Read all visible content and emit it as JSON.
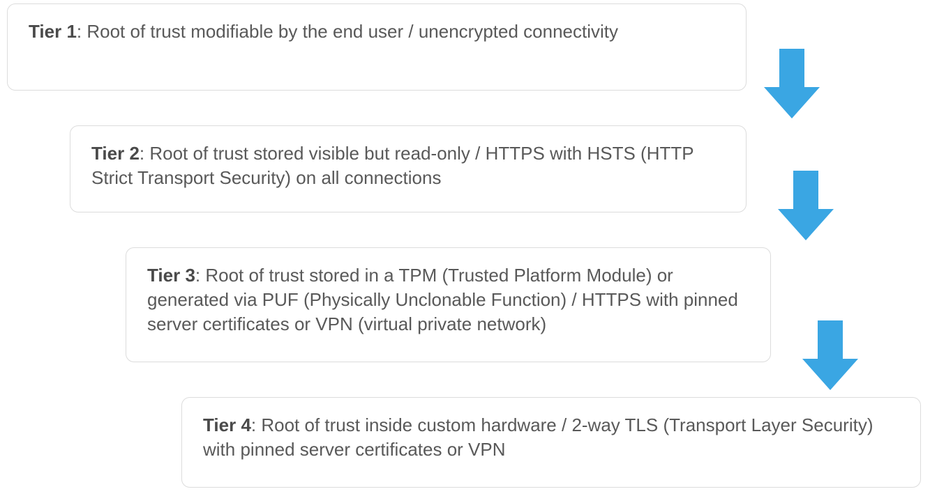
{
  "colors": {
    "arrow": "#3aa6e3",
    "border": "#dcdcdc",
    "text": "#595959"
  },
  "tiers": [
    {
      "label": "Tier 1",
      "text": ": Root of trust modifiable by the end user / unencrypted connectivity"
    },
    {
      "label": "Tier 2",
      "text": ": Root of trust stored visible but read-only / HTTPS with HSTS (HTTP Strict Transport Security) on all connections"
    },
    {
      "label": "Tier 3",
      "text": ": Root of trust stored in a TPM (Trusted Platform Module) or generated via PUF (Physically Unclonable Function) / HTTPS with pinned server certificates or VPN (virtual private network)"
    },
    {
      "label": "Tier 4",
      "text": ": Root of trust inside custom hardware / 2-way TLS (Transport Layer Security) with pinned server certificates or VPN"
    }
  ]
}
